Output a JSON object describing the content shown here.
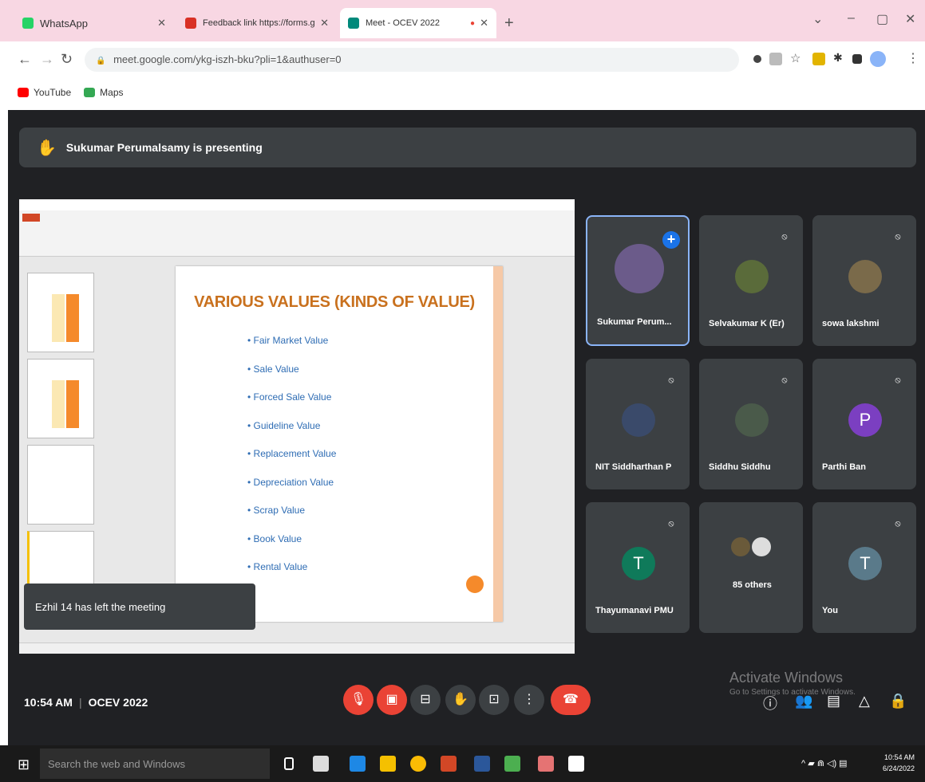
{
  "browser": {
    "tabs": [
      {
        "label": "WhatsApp",
        "active": false
      },
      {
        "label": "Feedback link https://forms.gle",
        "active": false
      },
      {
        "label": "Meet - OCEV 2022",
        "active": true
      }
    ],
    "new_tab": "+",
    "window_controls": [
      "⌄",
      "–",
      "▢",
      "✕"
    ],
    "url": "meet.google.com/ykg-iszh-bku?pli=1&authuser=0",
    "bookmarks": [
      "YouTube",
      "Maps"
    ]
  },
  "meet": {
    "presenting_banner": "Sukumar Perumalsamy is presenting",
    "slide": {
      "title": "VARIOUS VALUES (KINDS OF VALUE)",
      "bullets": [
        "• Fair Market Value",
        "• Sale Value",
        "• Forced Sale Value",
        "• Guideline Value",
        "• Replacement Value",
        "• Depreciation Value",
        "• Scrap Value",
        "• Book Value",
        "• Rental Value"
      ]
    },
    "toast": "Ezhil 14 has left the meeting",
    "participants": [
      {
        "name": "Sukumar Perum...",
        "initial": "",
        "color": "#6b5b8a"
      },
      {
        "name": "Selvakumar K (Er)",
        "initial": "",
        "color": "#5a6b3a"
      },
      {
        "name": "sowa lakshmi",
        "initial": "",
        "color": "#7a6a4a"
      },
      {
        "name": "NIT Siddharthan P",
        "initial": "",
        "color": "#3a4a6a"
      },
      {
        "name": "Siddhu Siddhu",
        "initial": "",
        "color": "#4a5a4a"
      },
      {
        "name": "Parthi Ban",
        "initial": "P",
        "color": "#7b3fc1"
      },
      {
        "name": "Thayumanavi PMU",
        "initial": "T",
        "color": "#0f7a5a"
      },
      {
        "name": "85 others",
        "initial": "",
        "color": "#555"
      },
      {
        "name": "You",
        "initial": "T",
        "color": "#5a7a8a"
      }
    ],
    "time": "10:54 AM",
    "meeting_name": "OCEV 2022",
    "watermark_title": "Activate Windows",
    "watermark_sub": "Go to Settings to activate Windows."
  },
  "taskbar": {
    "search_placeholder": "Search the web and Windows",
    "clock_time": "10:54 AM",
    "clock_date": "6/24/2022"
  }
}
